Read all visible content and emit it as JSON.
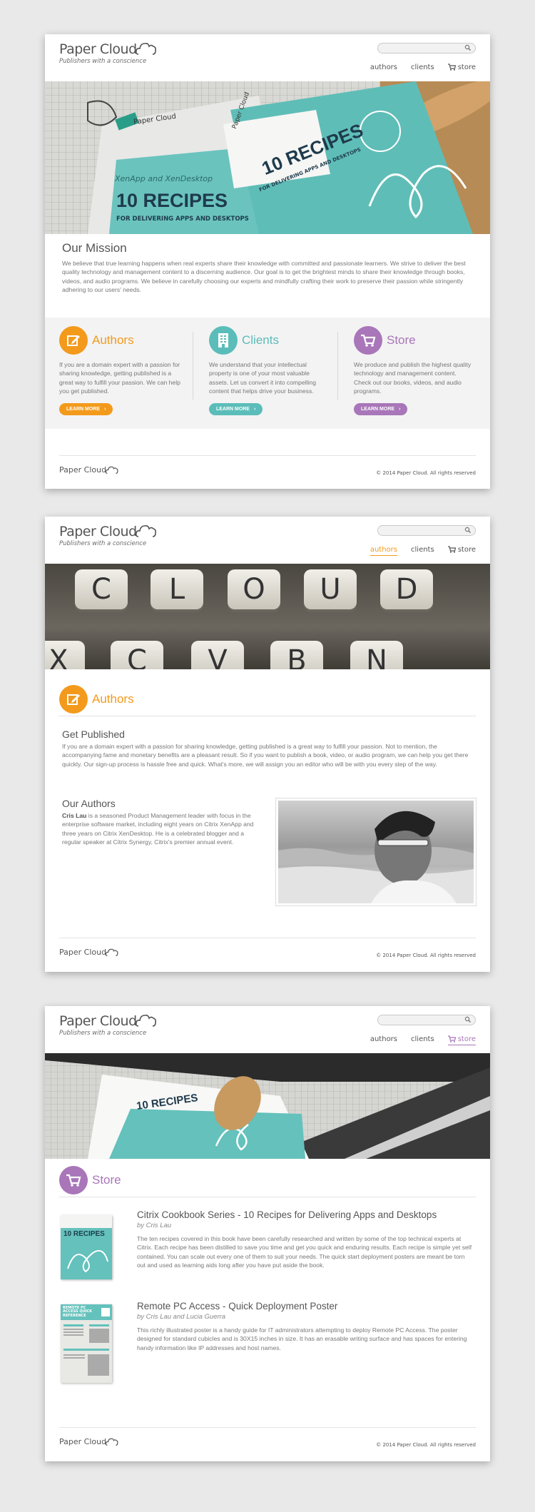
{
  "brand": {
    "name_paper": "Paper",
    "name_cloud": "Cloud",
    "tagline": "Publishers with a conscience"
  },
  "nav": {
    "authors": "authors",
    "clients": "clients",
    "store": "store"
  },
  "search": {
    "placeholder": ""
  },
  "footer": {
    "copyright": "© 2014 Paper Cloud. All rights reserved"
  },
  "colors": {
    "orange": "#f39a1c",
    "teal": "#5bbdb9",
    "purple": "#a876b9"
  },
  "home": {
    "hero": {
      "cover_brand": "Paper Cloud",
      "cover_subtitle": "XenApp and XenDesktop",
      "cover_title": "10 RECIPES",
      "cover_tagline": "FOR DELIVERING APPS AND DESKTOPS"
    },
    "mission": {
      "title": "Our Mission",
      "text": "We believe that true learning happens when real experts share their knowledge with committed and passionate learners. We strive to deliver the best quality technology and management content to a discerning audience. Our goal is to get the brightest minds to share their knowledge through books, videos, and audio programs. We believe in carefully choosing our experts and mindfully crafting their work to preserve their passion while stringently adhering to our users' needs."
    },
    "features": [
      {
        "title": "Authors",
        "icon": "pencil-icon",
        "text": "If you are a domain expert with a passion for sharing knowledge, getting published is a great way to fulfill your passion. We can help you get published.",
        "button": "LEARN MORE"
      },
      {
        "title": "Clients",
        "icon": "building-icon",
        "text": "We understand that your intellectual property is one of your most valuable assets. Let us convert it into compelling content that helps drive your business.",
        "button": "LEARN MORE"
      },
      {
        "title": "Store",
        "icon": "cart-icon",
        "text": "We produce and publish the highest quality technology and management content. Check out our books, videos, and audio programs.",
        "button": "LEARN MORE"
      }
    ]
  },
  "authors_page": {
    "hero_keys_top": [
      "C",
      "L",
      "O",
      "U",
      "D"
    ],
    "hero_keys_bottom": [
      "X",
      "C",
      "V",
      "B",
      "N"
    ],
    "title": "Authors",
    "get_published": {
      "title": "Get Published",
      "text": "If you are a domain expert with a passion for sharing knowledge, getting published is a great way to fulfill your passion. Not to mention, the accompanying fame and monetary benefits are a pleasant result. So if you want to publish a book, video, or audio program, we can help you get there quickly. Our sign-up process is hassle free and quick. What's more, we will assign you an editor who will be with you every step of the way."
    },
    "our_authors": {
      "title": "Our Authors",
      "name": "Cris Lau",
      "bio": " is a seasoned Product Management leader with focus in the enterprise software market, including eight years on Citrix XenApp and three years on Citrix XenDesktop. He is a celebrated blogger and a regular speaker at Citrix Synergy, Citrix's premier annual event."
    }
  },
  "store_page": {
    "title": "Store",
    "books": [
      {
        "title": "Citrix Cookbook Series - 10 Recipes for Delivering Apps and Desktops",
        "by": "by Cris Lau",
        "text": "The ten recipes covered in this book have been carefully researched and written by some of the top technical experts at Citrix. Each recipe has been distilled to save you time and get you quick and enduring results. Each recipe is simple yet self contained. You can scale out every one of them to suit your needs. The quick start deployment posters are meant be torn out and used as learning aids long after you have put aside the book.",
        "cover_label": "10 RECIPES"
      },
      {
        "title": "Remote PC Access - Quick Deployment Poster",
        "by": "by Cris Lau and Lucia Guerra",
        "text": "This richly illustrated poster is a handy guide for IT administrators attempting to deploy Remote PC Access. The poster designed for standard cubicles and is 30X15 inches in size. It has an erasable writing surface and has spaces for entering handy information like IP addresses and host names.",
        "cover_label": "REMOTE PC ACCESS QUICK REFERENCE"
      }
    ]
  }
}
